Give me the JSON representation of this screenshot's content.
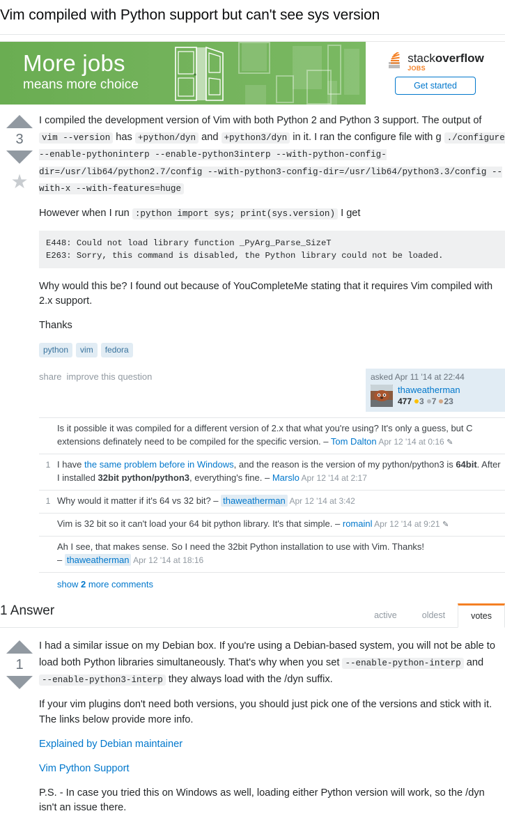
{
  "question": {
    "title": "Vim compiled with Python support but can't see sys version",
    "votes": "3",
    "body": {
      "p1_a": "I compiled the development version of Vim with both Python 2 and Python 3 support. The output of ",
      "code_vim_version": "vim --version",
      "p1_b": " has ",
      "code_python_dyn": "+python/dyn",
      "p1_c": " and ",
      "code_python3_dyn": "+python3/dyn",
      "p1_d": " in it. I ran the configure file with g ",
      "code_configure": "./configure --enable-pythoninterp --enable-python3interp --with-python-config-dir=/usr/lib64/python2.7/config --with-python3-config-dir=/usr/lib64/python3.3/config --with-x --with-features=huge",
      "p2_a": "However when I run ",
      "code_python_cmd": ":python import sys; print(sys.version)",
      "p2_b": " I get",
      "error_block": "E448: Could not load library function _PyArg_Parse_SizeT\nE263: Sorry, this command is disabled, the Python library could not be loaded.",
      "p3": "Why would this be? I found out because of YouCompleteMe stating that it requires Vim compiled with 2.x support.",
      "p4": "Thanks"
    },
    "tags": [
      "python",
      "vim",
      "fedora"
    ],
    "menu": {
      "share": "share",
      "improve": "improve this question"
    },
    "usercard": {
      "action": "asked Apr 11 '14 at 22:44",
      "username": "thaweatherman",
      "reputation": "477",
      "gold": "3",
      "silver": "7",
      "bronze": "23"
    }
  },
  "comments": [
    {
      "score": "",
      "text_before": "Is it possible it was compiled for a different version of 2.x that what you're using? It's only a guess, but C extensions definately need to be compiled for the specific version. ",
      "dash": "– ",
      "user": "Tom Dalton",
      "user_highlight": false,
      "date": " Apr 12 '14 at 0:16",
      "pencil": true
    },
    {
      "score": "1",
      "text_before": "I have ",
      "link": "the same problem before in Windows",
      "text_mid": ", and the reason is the version of my python/python3 is ",
      "bold1": "64bit",
      "text_mid2": ". After I installed ",
      "bold2": "32bit python/python3",
      "text_after": ", everything's fine. ",
      "dash": "– ",
      "user": "Marslo",
      "user_highlight": false,
      "date": " Apr 12 '14 at 2:17",
      "pencil": false
    },
    {
      "score": "1",
      "text_before": "Why would it matter if it's 64 vs 32 bit? ",
      "dash": "– ",
      "user": "thaweatherman",
      "user_highlight": true,
      "date": " Apr 12 '14 at 3:42",
      "pencil": false
    },
    {
      "score": "",
      "text_before": "Vim is 32 bit so it can't load your 64 bit python library. It's that simple. ",
      "dash": "– ",
      "user": "romainl",
      "user_highlight": false,
      "date": " Apr 12 '14 at 9:21",
      "pencil": true
    },
    {
      "score": "",
      "text_before": "Ah I see, that makes sense. So I need the 32bit Python installation to use with Vim. Thanks! ",
      "dash": "– ",
      "user": "thaweatherman",
      "user_highlight": true,
      "date": " Apr 12 '14 at 18:16",
      "pencil": false
    }
  ],
  "show_more": {
    "prefix": "show ",
    "count": "2",
    "suffix": " more comments"
  },
  "answers_header": {
    "count_label": "1 Answer",
    "tabs": [
      {
        "label": "active",
        "active": false
      },
      {
        "label": "oldest",
        "active": false
      },
      {
        "label": "votes",
        "active": true
      }
    ]
  },
  "answer": {
    "votes": "1",
    "p1_a": "I had a similar issue on my Debian box. If you're using a Debian-based system, you will not be able to load both Python libraries simultaneously. That's why when you set ",
    "code1": "--enable-python-interp",
    "p1_b": " and ",
    "code2": "--enable-python3-interp",
    "p1_c": " they always load with the /dyn suffix.",
    "p2": "If your vim plugins don't need both versions, you should just pick one of the versions and stick with it. The links below provide more info.",
    "link1": "Explained by Debian maintainer",
    "link2": "Vim Python Support",
    "p3": "P.S. - In case you tried this on Windows as well, loading either Python version will work, so the /dyn isn't an issue there."
  },
  "ad": {
    "headline": "More jobs",
    "subline": "means more choice",
    "brand_light": "stack",
    "brand_bold": "overflow",
    "brand_sub": "JOBS",
    "cta": "Get started",
    "bg_color": "#6fb053",
    "cta_color": "#0077cc",
    "jobs_accent": "#f48024"
  }
}
